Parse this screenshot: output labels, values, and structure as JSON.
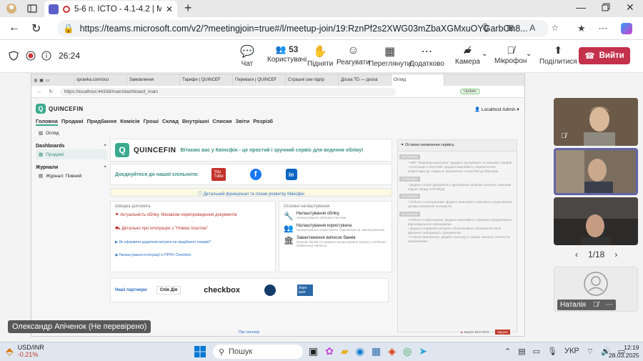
{
  "browser": {
    "active_tab_title": "5-6 п. ICTO - 4.1-4.2 | Micros",
    "url": "https://teams.microsoft.com/v2/?meetingjoin=true#/l/meetup-join/19:RznPf2s2XWG03mZbaXGMxuOYGarbOn8..."
  },
  "meeting": {
    "timer": "26:24",
    "participants_count": "53",
    "actions": {
      "chat": "Чат",
      "people": "Користувачі",
      "raise": "Підняти",
      "react": "Реагувати",
      "view": "Переглянути",
      "more": "Додатково",
      "camera": "Камера",
      "mic": "Мікрофон",
      "share": "Поділитися"
    },
    "leave_label": "Вийти",
    "pager": "1/18",
    "speaker_caption": "Олександр Апіченок (Не перевірено)",
    "participant_name": "Наталія"
  },
  "shared": {
    "tabs": [
      "spravka.com/ocu",
      "Замовлення",
      "Тарифи | QUINCEF",
      "Переваги | QUINCEF",
      "Страшні сни підпр",
      "Доска TD — доска",
      "Огляд"
    ],
    "url": "https://localhost:44338/main/dashboard_main",
    "update_btn": "Update",
    "brand": "QUINCEFIN",
    "user": "Localhost Admin",
    "menu": [
      "Головна",
      "Продажі",
      "Придбання",
      "Комісія",
      "Гроші",
      "Склад",
      "Внутрішні",
      "Списки",
      "Звіти",
      "Розрізб"
    ],
    "sidebar": {
      "overview": "Огляд",
      "dashboards": "Dashboards",
      "sales": "Продажі",
      "journals": "Журнали",
      "journal_full": "Журнал: Повний"
    },
    "welcome": "Вітаємо вас у Квінсфін - це простий і зручний сервіс для ведення обліку!",
    "join": "Доєднуйтеся до нашої спільноти:",
    "detail_link": "Детальний функціонал та плани розвитку Квінсфін",
    "quick_help": {
      "title": "Швидка допомога",
      "items": [
        "Актуальність обліку. Механізм перепроведення документів",
        "Детально про інтеграцію з \"Новою поштою\"",
        "Як оформити додаткові витрати на придбання товарів?",
        "Налаштування інтеграції із ПРРО Checkbox"
      ]
    },
    "settings": {
      "title": "Основні налаштування",
      "items": [
        {
          "title": "Налаштування обліку",
          "sub": "Налаштування облікової системи"
        },
        {
          "title": "Налаштування користувача",
          "sub": "Налаштування користувача. Параметри за замовчуванням"
        },
        {
          "title": "Завантаження виписок банків",
          "sub": "Перелік банків та правила налаштування імпорту платіжних банківських виписок"
        }
      ]
    },
    "partners_label": "Наші партнери:",
    "partner_names": [
      "Спів Дія",
      "checkbox",
      "Хоро шоп"
    ],
    "updates_title": "Останні оновлення сервісу",
    "updates": [
      {
        "date": "20.03.2025",
        "items": [
          "ЗФР \"Взаєморозрахунки\": Додано групування та ланками товарів",
          "Інтеграція з KeyCRM: Додано можливість перенесення коментарю до товару в замовленні з KeyCRM до Квінсфін"
        ]
      },
      {
        "date": "17.03.2025",
        "items": [
          "Додано опцію друкувати в друкованих формах колонку з митним кодом товару (УКТЗЕД)"
        ]
      },
      {
        "date": "13.03.2025",
        "items": [
          "Роботи з контрактами: Додано можливість масового редагування деяких реквізитів контрактів"
        ]
      },
      {
        "date": "10.03.2025",
        "items": [
          "Роботи з партнерами: Додано можливість групового редагування відповідального менеджера",
          "Додано опційний контроль обов'язкового заповнення поля Джерело інформації у документах",
          "Список Замовлень: Додано колонку із сумою чекаючу оплати по Замовленню"
        ]
      }
    ],
    "footer_link": "Про систему",
    "version": "версія 10.0.7973",
    "feedback": "відгуки"
  },
  "taskbar": {
    "ticker": "USD/INR",
    "change": "-0.21%",
    "search": "Пошук",
    "lang": "УКР",
    "time": "12:19",
    "date": "28.03.2025"
  }
}
